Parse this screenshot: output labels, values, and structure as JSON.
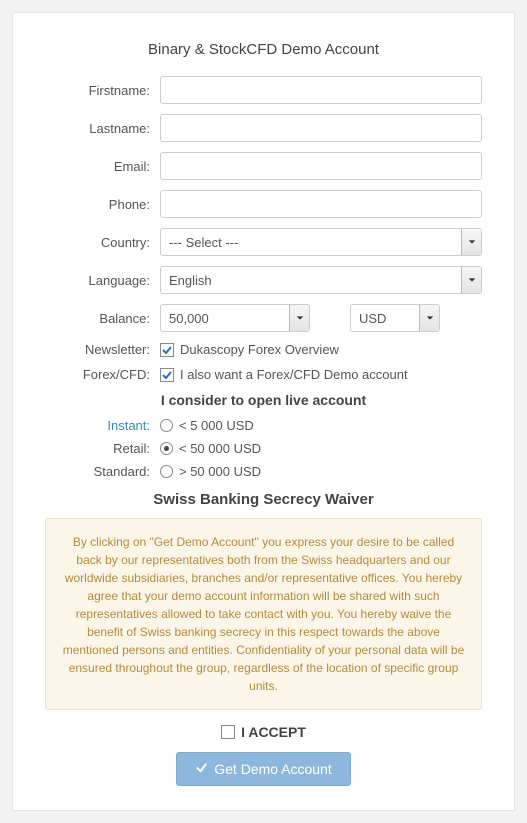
{
  "title": "Binary & StockCFD Demo Account",
  "fields": {
    "firstname": {
      "label": "Firstname:",
      "value": ""
    },
    "lastname": {
      "label": "Lastname:",
      "value": ""
    },
    "email": {
      "label": "Email:",
      "value": ""
    },
    "phone": {
      "label": "Phone:",
      "value": ""
    },
    "country": {
      "label": "Country:",
      "selected": "--- Select ---"
    },
    "language": {
      "label": "Language:",
      "selected": "English"
    },
    "balance": {
      "label": "Balance:",
      "amount": "50,000",
      "currency": "USD"
    },
    "newsletter": {
      "label": "Newsletter:",
      "text": "Dukascopy Forex Overview",
      "checked": true
    },
    "forexcfd": {
      "label": "Forex/CFD:",
      "text": "I also want a Forex/CFD Demo account",
      "checked": true
    }
  },
  "liveAccount": {
    "heading": "I consider to open live account",
    "options": [
      {
        "key": "instant",
        "label": "Instant:",
        "text": "< 5 000 USD",
        "selected": false,
        "link": true
      },
      {
        "key": "retail",
        "label": "Retail:",
        "text": "< 50 000 USD",
        "selected": true,
        "link": false
      },
      {
        "key": "standard",
        "label": "Standard:",
        "text": "> 50 000 USD",
        "selected": false,
        "link": false
      }
    ]
  },
  "waiver": {
    "title": "Swiss Banking Secrecy Waiver",
    "body": "By clicking on \"Get Demo Account\" you express your desire to be called back by our representatives both from the Swiss headquarters and our worldwide subsidiaries, branches and/or representative offices. You hereby agree that your demo account information will be shared with such representatives allowed to take contact with you. You hereby waive the benefit of Swiss banking secrecy in this respect towards the above mentioned persons and entities. Confidentiality of your personal data will be ensured throughout the group, regardless of the location of specific group units."
  },
  "accept": {
    "label": "I ACCEPT",
    "checked": false
  },
  "submit": {
    "label": "Get Demo Account"
  }
}
